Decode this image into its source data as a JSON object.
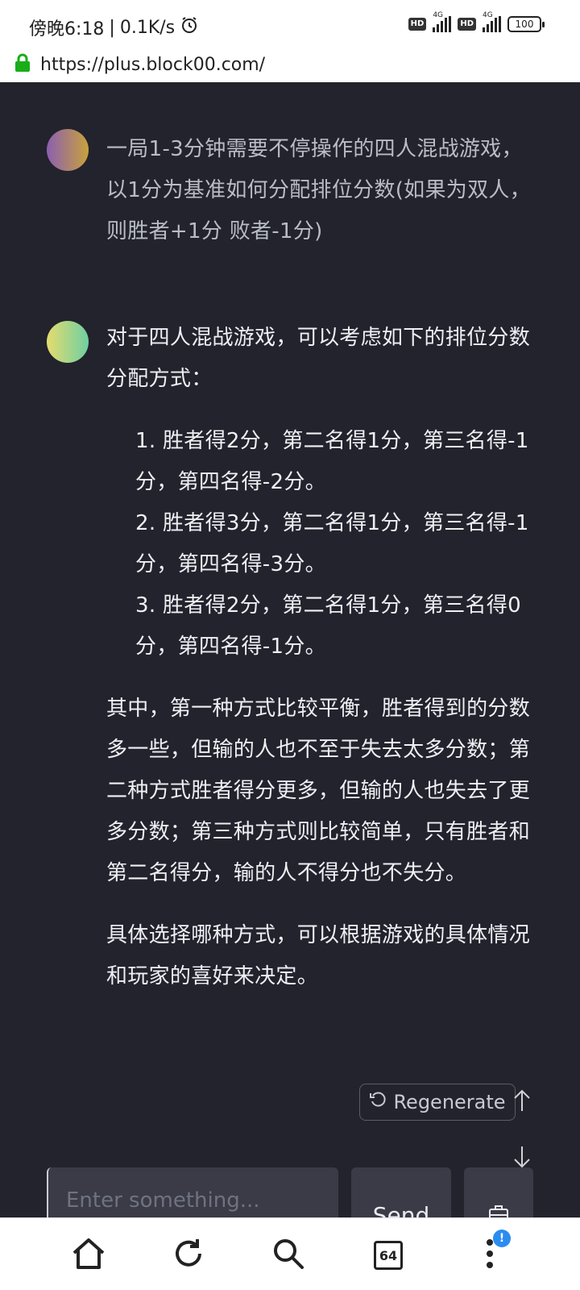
{
  "status_bar": {
    "time": "傍晚6:18",
    "network_speed": "0.1K/s",
    "separator": "|",
    "hd1": "HD",
    "net1": "4G",
    "hd2": "HD",
    "net2": "4G",
    "battery": "100"
  },
  "browser": {
    "url": "https://plus.block00.com/"
  },
  "conversation": {
    "user_message": "一局1-3分钟需要不停操作的四人混战游戏，以1分为基准如何分配排位分数(如果为双人，则胜者+1分 败者-1分)",
    "bot_intro": "对于四人混战游戏，可以考虑如下的排位分数分配方式：",
    "bot_options": [
      "1. 胜者得2分，第二名得1分，第三名得-1分，第四名得-2分。",
      "2. 胜者得3分，第二名得1分，第三名得-1分，第四名得-3分。",
      "3. 胜者得2分，第二名得1分，第三名得0分，第四名得-1分。"
    ],
    "bot_analysis": "其中，第一种方式比较平衡，胜者得到的分数多一些，但输的人也不至于失去太多分数；第二种方式胜者得分更多，但输的人也失去了更多分数；第三种方式则比较简单，只有胜者和第二名得分，输的人不得分也不失分。",
    "bot_conclusion": "具体选择哪种方式，可以根据游戏的具体情况和玩家的喜好来决定。"
  },
  "controls": {
    "regenerate_label": "Regenerate",
    "input_placeholder": "Enter something...",
    "send_label": "Send"
  },
  "bottom_nav": {
    "tab_count": "64",
    "notification_badge": "!"
  },
  "colors": {
    "chat_background": "#22232c",
    "input_background": "#3a3b47",
    "notification_blue": "#2b8cf0",
    "lock_green": "#1aad19"
  },
  "icons": [
    "alarm-icon",
    "lock-icon",
    "regenerate-icon",
    "arrow-up-icon",
    "arrow-down-icon",
    "toolbox-icon",
    "home-icon",
    "refresh-icon",
    "search-icon",
    "tabs-icon",
    "more-icon"
  ]
}
